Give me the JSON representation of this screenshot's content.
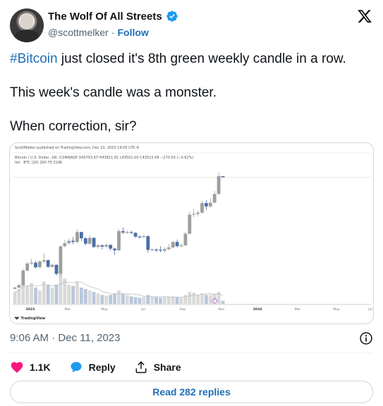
{
  "author": {
    "name": "The Wolf Of All Streets",
    "handle": "@scottmelker",
    "separator": "·",
    "follow_label": "Follow",
    "verified": true
  },
  "tweet": {
    "hashtag": "#Bitcoin",
    "line1_rest": " just closed it's 8th green weekly candle in a row.",
    "line2": "This week's candle was a monster.",
    "line3": "When correction, sir?"
  },
  "media": {
    "published_note": "ScottMelker published on TradingView.com, Dec 10, 2023 19:05 UTC-6",
    "ohlc_line": "Bitcoin / U.S. Dollar, 1W, COINBASE  O43793.67  H43811.81  L43501.00  C43523.09  −270.59 (−0.62%)",
    "volume_line": "Vol · BTC (20)  260  75.319K",
    "footer_brand": "TradingView",
    "x_ticks": [
      "2023",
      "Mar",
      "May",
      "Jul",
      "Sep",
      "Nov",
      "2024",
      "Mar",
      "May",
      "Jul"
    ],
    "marker_label": "F"
  },
  "chart_data": {
    "type": "candlestick",
    "title": "Bitcoin / U.S. Dollar, 1W, COINBASE",
    "x": [
      "2023",
      "Mar",
      "May",
      "Jul",
      "Sep",
      "Nov",
      "2024",
      "Mar",
      "May",
      "Jul"
    ],
    "candles": [
      {
        "o": 16600,
        "c": 16900,
        "h": 17100,
        "l": 16400
      },
      {
        "o": 16900,
        "c": 17500,
        "h": 17900,
        "l": 16800
      },
      {
        "o": 17500,
        "c": 21000,
        "h": 21400,
        "l": 17400
      },
      {
        "o": 21000,
        "c": 22700,
        "h": 23100,
        "l": 20800
      },
      {
        "o": 22700,
        "c": 22900,
        "h": 23900,
        "l": 22400
      },
      {
        "o": 22900,
        "c": 21800,
        "h": 23300,
        "l": 21500
      },
      {
        "o": 21800,
        "c": 23200,
        "h": 23500,
        "l": 21600
      },
      {
        "o": 23200,
        "c": 23500,
        "h": 25200,
        "l": 22800
      },
      {
        "o": 23500,
        "c": 21900,
        "h": 23800,
        "l": 21600
      },
      {
        "o": 21900,
        "c": 22400,
        "h": 22600,
        "l": 21700
      },
      {
        "o": 22400,
        "c": 20200,
        "h": 22500,
        "l": 19800
      },
      {
        "o": 20200,
        "c": 26900,
        "h": 27000,
        "l": 19600
      },
      {
        "o": 26900,
        "c": 27600,
        "h": 28400,
        "l": 26600
      },
      {
        "o": 27600,
        "c": 28200,
        "h": 28800,
        "l": 27300
      },
      {
        "o": 28200,
        "c": 27900,
        "h": 29100,
        "l": 27400
      },
      {
        "o": 27900,
        "c": 30300,
        "h": 30900,
        "l": 27600
      },
      {
        "o": 30300,
        "c": 28800,
        "h": 30400,
        "l": 28200
      },
      {
        "o": 28800,
        "c": 27500,
        "h": 29100,
        "l": 27100
      },
      {
        "o": 27500,
        "c": 28900,
        "h": 29500,
        "l": 27200
      },
      {
        "o": 28900,
        "c": 26700,
        "h": 29000,
        "l": 26500
      },
      {
        "o": 26700,
        "c": 27100,
        "h": 27500,
        "l": 26300
      },
      {
        "o": 27100,
        "c": 26800,
        "h": 27300,
        "l": 26100
      },
      {
        "o": 26800,
        "c": 27200,
        "h": 27600,
        "l": 26500
      },
      {
        "o": 27200,
        "c": 26300,
        "h": 27400,
        "l": 25800
      },
      {
        "o": 26300,
        "c": 25900,
        "h": 26500,
        "l": 24800
      },
      {
        "o": 25900,
        "c": 30500,
        "h": 31000,
        "l": 25700
      },
      {
        "o": 30500,
        "c": 30200,
        "h": 31400,
        "l": 29900
      },
      {
        "o": 30200,
        "c": 30300,
        "h": 30700,
        "l": 29900
      },
      {
        "o": 30300,
        "c": 30100,
        "h": 30600,
        "l": 29800
      },
      {
        "o": 30100,
        "c": 29200,
        "h": 30300,
        "l": 28900
      },
      {
        "o": 29200,
        "c": 29100,
        "h": 29500,
        "l": 28800
      },
      {
        "o": 29100,
        "c": 29300,
        "h": 29700,
        "l": 28900
      },
      {
        "o": 29300,
        "c": 26000,
        "h": 29500,
        "l": 25300
      },
      {
        "o": 26000,
        "c": 26100,
        "h": 26400,
        "l": 25700
      },
      {
        "o": 26100,
        "c": 26000,
        "h": 26300,
        "l": 25500
      },
      {
        "o": 26000,
        "c": 25800,
        "h": 26900,
        "l": 25400
      },
      {
        "o": 25800,
        "c": 26200,
        "h": 26600,
        "l": 25200
      },
      {
        "o": 26200,
        "c": 26600,
        "h": 27400,
        "l": 25900
      },
      {
        "o": 26600,
        "c": 27900,
        "h": 28200,
        "l": 26400
      },
      {
        "o": 27900,
        "c": 26900,
        "h": 28500,
        "l": 26600
      },
      {
        "o": 26900,
        "c": 27100,
        "h": 27600,
        "l": 26600
      },
      {
        "o": 27100,
        "c": 29900,
        "h": 30400,
        "l": 26900
      },
      {
        "o": 29900,
        "c": 34500,
        "h": 35200,
        "l": 29800
      },
      {
        "o": 34500,
        "c": 34700,
        "h": 35900,
        "l": 33900
      },
      {
        "o": 34700,
        "c": 35000,
        "h": 35400,
        "l": 34100
      },
      {
        "o": 35000,
        "c": 37300,
        "h": 37900,
        "l": 34800
      },
      {
        "o": 37300,
        "c": 36500,
        "h": 38000,
        "l": 35600
      },
      {
        "o": 36500,
        "c": 37400,
        "h": 38400,
        "l": 36100
      },
      {
        "o": 37400,
        "c": 39500,
        "h": 40200,
        "l": 37300
      },
      {
        "o": 39500,
        "c": 43800,
        "h": 44700,
        "l": 39300
      },
      {
        "o": 43793.67,
        "c": 43523.09,
        "h": 43811.81,
        "l": 43501.0
      }
    ],
    "volume": [
      16,
      20,
      36,
      24,
      28,
      22,
      18,
      30,
      26,
      22,
      26,
      40,
      34,
      26,
      24,
      30,
      22,
      20,
      18,
      16,
      14,
      12,
      11,
      12,
      14,
      18,
      14,
      12,
      10,
      9,
      8,
      9,
      12,
      10,
      9,
      8,
      9,
      9,
      10,
      9,
      8,
      12,
      16,
      15,
      12,
      14,
      12,
      12,
      13,
      16,
      4
    ],
    "colors": {
      "up": "#9e9e9e",
      "down": "#4a6fa5",
      "volume_up": "#d9d9d9",
      "volume_down": "#b9c6dc",
      "ma_line": "#bdbdbd"
    }
  },
  "timestamp": "9:06 AM · Dec 11, 2023",
  "actions": {
    "likes": "1.1K",
    "reply_label": "Reply",
    "share_label": "Share"
  },
  "read_replies_label": "Read 282 replies"
}
